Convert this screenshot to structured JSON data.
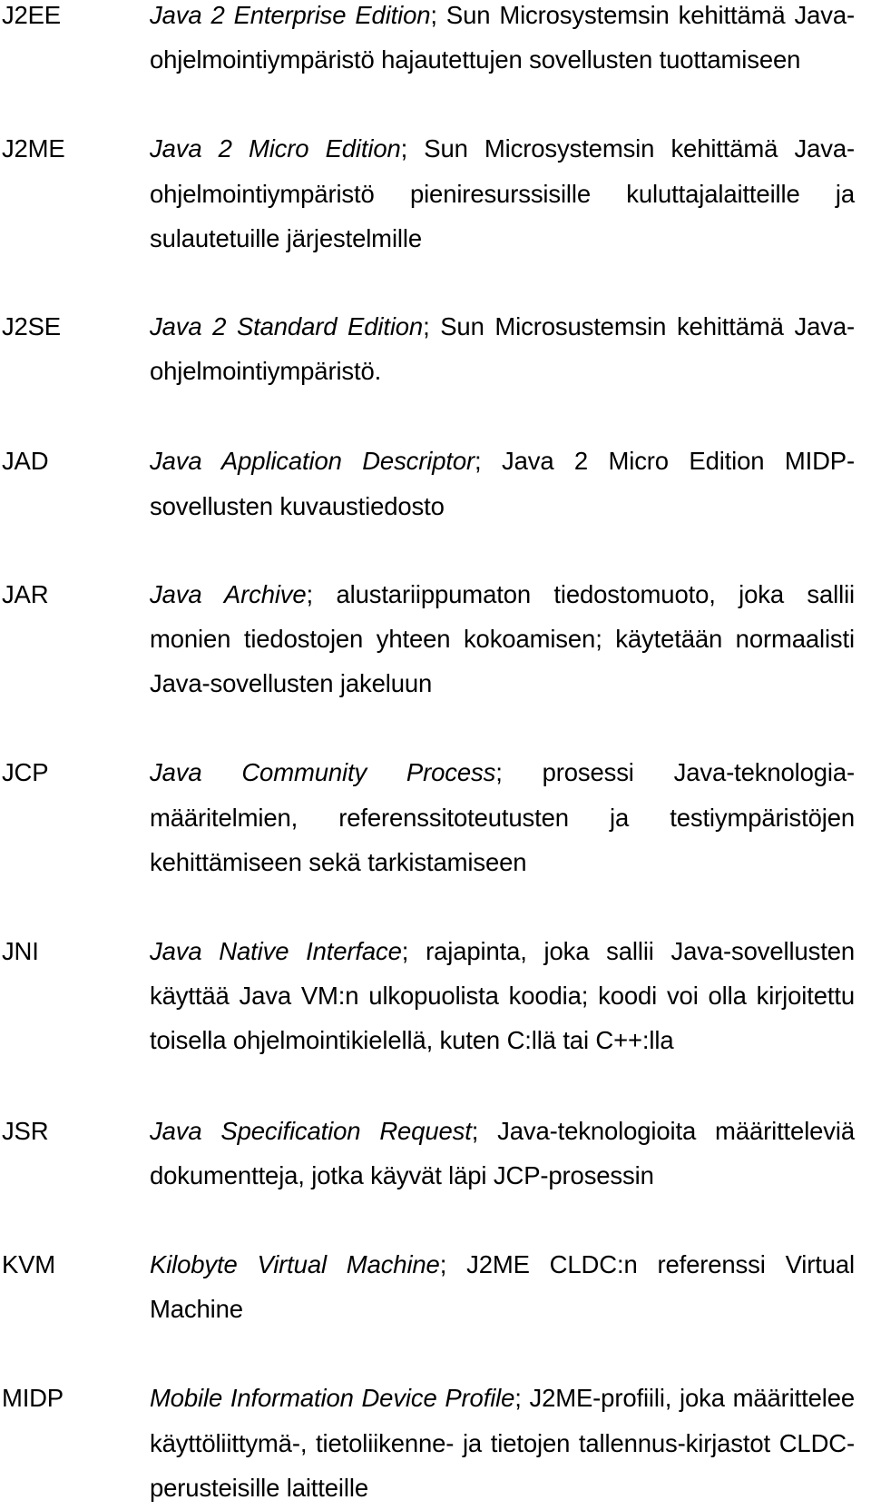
{
  "document": {
    "language": "fi",
    "kind": "glossary-page",
    "entries": [
      {
        "term": "J2EE",
        "expansion": "Java 2 Enterprise Edition",
        "separator": "; ",
        "description": "Sun Microsystemsin kehittämä Java-ohjelmointiympäristö hajautettujen sovellusten tuottamiseen",
        "gap_class": "gap-0"
      },
      {
        "term": "J2ME",
        "expansion": "Java 2 Micro Edition",
        "separator": "; ",
        "description": "Sun Microsystemsin kehittämä Java-ohjelmointiympäristö pieniresurssisille kuluttajalaitteille ja sulautetuille järjestelmille",
        "gap_class": "gap-1"
      },
      {
        "term": "J2SE",
        "expansion": "Java 2 Standard Edition",
        "separator": "; ",
        "description": "Sun Microsustemsin kehittämä Java-ohjelmointiympäristö.",
        "gap_class": "gap-2"
      },
      {
        "term": "JAD",
        "expansion": "Java Application Descriptor",
        "separator": "; ",
        "description": "Java 2 Micro Edition MIDP-sovellusten kuvaustiedosto",
        "gap_class": "gap-3"
      },
      {
        "term": "JAR",
        "expansion": "Java Archive",
        "separator": "; ",
        "description": "alustariippumaton tiedostomuoto, joka sallii monien tiedostojen yhteen kokoamisen; käytetään normaalisti Java-sovellusten jakeluun",
        "gap_class": "gap-4"
      },
      {
        "term": "JCP",
        "expansion": "Java Community Process",
        "separator": "; ",
        "description": "prosessi Java-teknologia-määritelmien, referenssitoteutusten ja testiympäristöjen kehittämiseen sekä tarkistamiseen",
        "gap_class": "gap-5"
      },
      {
        "term": "JNI",
        "expansion": "Java Native Interface",
        "separator": "; ",
        "description": "rajapinta, joka sallii Java-sovellusten käyttää Java VM:n ulkopuolista koodia; koodi voi olla kirjoitettu toisella ohjelmointikielellä, kuten C:llä tai C++:lla",
        "gap_class": "gap-6"
      },
      {
        "term": "JSR",
        "expansion": "Java Specification Request",
        "separator": "; ",
        "description": "Java-teknologioita määritteleviä dokumentteja, jotka käyvät läpi JCP-prosessin",
        "gap_class": "gap-7"
      },
      {
        "term": "KVM",
        "expansion": "Kilobyte Virtual Machine",
        "separator": "; ",
        "description": "J2ME CLDC:n referenssi Virtual Machine",
        "gap_class": "gap-8"
      },
      {
        "term": "MIDP",
        "expansion": "Mobile Information Device Profile",
        "separator": "; ",
        "description": "J2ME-profiili, joka määrittelee käyttöliittymä-, tietoliikenne- ja tietojen tallennus-kirjastot CLDC-perusteisille laitteille",
        "gap_class": "gap-9"
      }
    ]
  }
}
